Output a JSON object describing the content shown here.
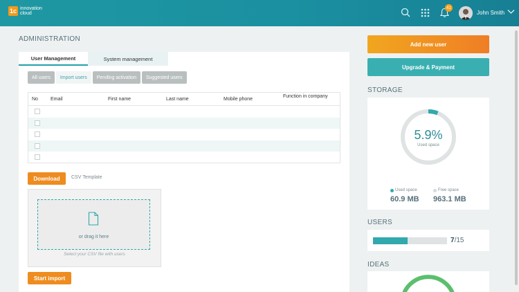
{
  "header": {
    "logo_badge": "1c",
    "logo_line1": "innovation",
    "logo_line2": "cloud",
    "notification_count": "41",
    "user_name": "John Smith",
    "icons": [
      "search-icon",
      "apps-grid-icon",
      "bell-icon",
      "avatar",
      "chevron-down-icon"
    ]
  },
  "page": {
    "title": "ADMINISTRATION"
  },
  "tabs": [
    {
      "label": "User Management",
      "active": true
    },
    {
      "label": "System management",
      "active": false
    }
  ],
  "subtabs": [
    {
      "label": "All users",
      "selected": false
    },
    {
      "label": "Import users",
      "selected": true
    },
    {
      "label": "Pending activation",
      "selected": false
    },
    {
      "label": "Suggested users",
      "selected": false
    }
  ],
  "table": {
    "columns": [
      "No",
      "Email",
      "First name",
      "Last name",
      "Mobile phone",
      "Function in company"
    ],
    "rows": [
      {},
      {},
      {},
      {},
      {}
    ]
  },
  "import": {
    "download_label": "Download",
    "csv_template": "CSV Template",
    "drag_text": "or drag it here",
    "select_text": "Select your CSV file with users",
    "start_label": "Start import"
  },
  "actions": {
    "add_user": "Add new user",
    "upgrade": "Upgrade & Payment"
  },
  "storage": {
    "title": "STORAGE",
    "percent_value": 5.9,
    "percent_label": "5.9%",
    "used_caption": "Used space",
    "used_label": "Used space",
    "free_label": "Free space",
    "used_value": "60.9 MB",
    "free_value": "963.1 MB",
    "colors": {
      "used": "#31a9ad",
      "free": "#dfe3e3"
    }
  },
  "users": {
    "title": "USERS",
    "current": "7",
    "total": "/15",
    "fraction": 0.4667
  },
  "ideas": {
    "title": "IDEAS"
  }
}
